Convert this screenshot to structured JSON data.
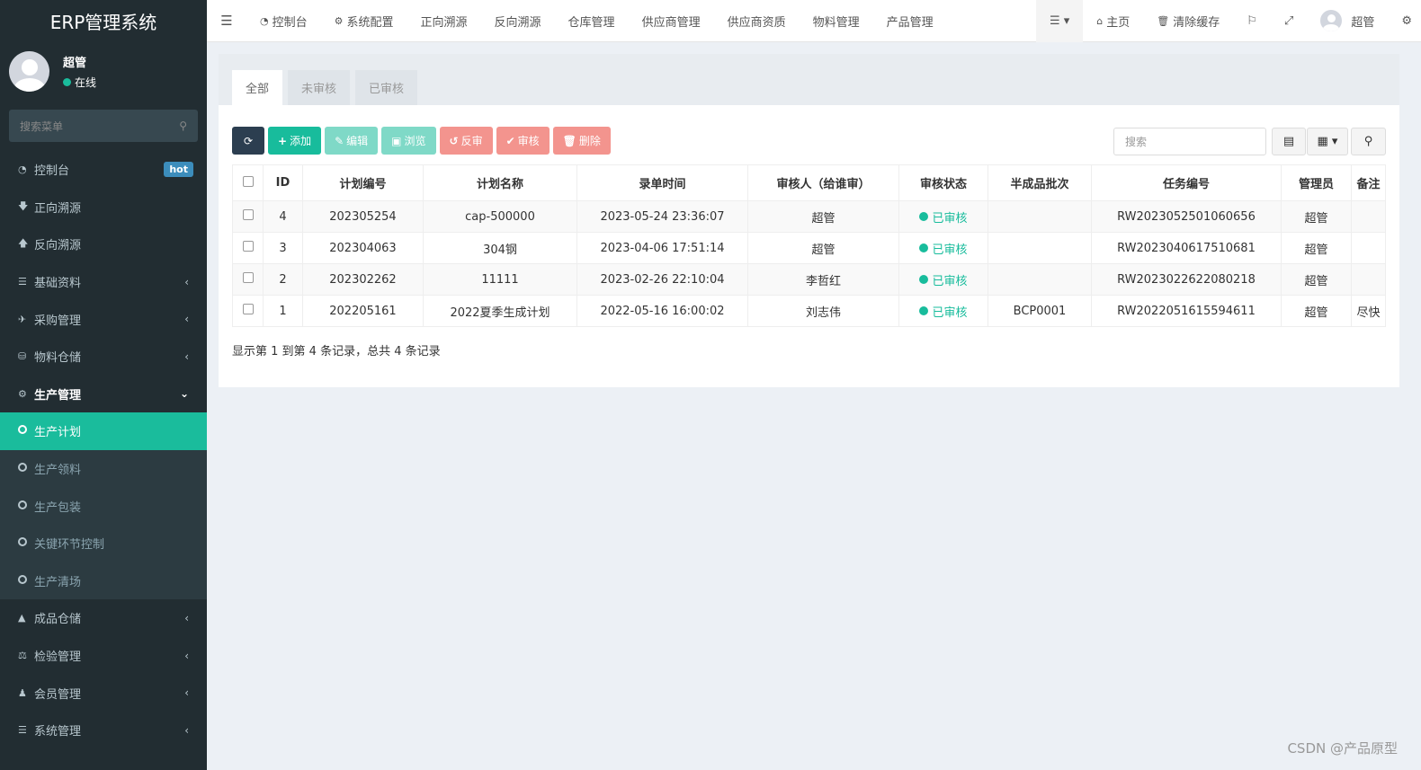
{
  "app": {
    "title": "ERP管理系统"
  },
  "user": {
    "name": "超管",
    "status": "在线"
  },
  "sidebar": {
    "search_placeholder": "搜索菜单",
    "items": [
      {
        "label": "控制台",
        "badge": "hot",
        "icon": "dashboard-icon"
      },
      {
        "label": "正向溯源",
        "icon": "arrow-down-icon"
      },
      {
        "label": "反向溯源",
        "icon": "arrow-up-icon"
      },
      {
        "label": "基础资料",
        "icon": "list-icon"
      },
      {
        "label": "采购管理",
        "icon": "plane-icon"
      },
      {
        "label": "物料仓储",
        "icon": "database-icon"
      },
      {
        "label": "生产管理",
        "icon": "gears-icon"
      },
      {
        "label": "生产计划",
        "icon": "circle-icon"
      },
      {
        "label": "生产领料",
        "icon": "circle-icon"
      },
      {
        "label": "生产包装",
        "icon": "circle-icon"
      },
      {
        "label": "关键环节控制",
        "icon": "circle-icon"
      },
      {
        "label": "生产清场",
        "icon": "circle-icon"
      },
      {
        "label": "成品仓储",
        "icon": "road-icon"
      },
      {
        "label": "检验管理",
        "icon": "balance-icon"
      },
      {
        "label": "会员管理",
        "icon": "user-icon"
      },
      {
        "label": "系统管理",
        "icon": "list-icon"
      }
    ]
  },
  "topnav": {
    "items": [
      "控制台",
      "系统配置",
      "正向溯源",
      "反向溯源",
      "仓库管理",
      "供应商管理",
      "供应商资质",
      "物料管理",
      "产品管理"
    ],
    "home": "主页",
    "clear_cache": "清除缓存",
    "user": "超管"
  },
  "tabs": [
    "全部",
    "未审核",
    "已审核"
  ],
  "toolbar": {
    "add": "添加",
    "edit": "编辑",
    "browse": "浏览",
    "unaudit": "反审",
    "audit": "审核",
    "delete": "删除"
  },
  "search_placeholder": "搜索",
  "table": {
    "headers": [
      "ID",
      "计划编号",
      "计划名称",
      "录单时间",
      "审核人（给谁审）",
      "审核状态",
      "半成品批次",
      "任务编号",
      "管理员",
      "备注"
    ],
    "rows": [
      {
        "id": "4",
        "code": "202305254",
        "name": "cap-500000",
        "time": "2023-05-24 23:36:07",
        "auditor": "超管",
        "status": "已审核",
        "batch": "",
        "task": "RW2023052501060656",
        "admin": "超管",
        "remark": ""
      },
      {
        "id": "3",
        "code": "202304063",
        "name": "304钢",
        "time": "2023-04-06 17:51:14",
        "auditor": "超管",
        "status": "已审核",
        "batch": "",
        "task": "RW2023040617510681",
        "admin": "超管",
        "remark": ""
      },
      {
        "id": "2",
        "code": "202302262",
        "name": "11111",
        "time": "2023-02-26 22:10:04",
        "auditor": "李哲红",
        "status": "已审核",
        "batch": "",
        "task": "RW2023022622080218",
        "admin": "超管",
        "remark": ""
      },
      {
        "id": "1",
        "code": "202205161",
        "name": "2022夏季生成计划",
        "time": "2022-05-16 16:00:02",
        "auditor": "刘志伟",
        "status": "已审核",
        "batch": "BCP0001",
        "task": "RW2022051615594611",
        "admin": "超管",
        "remark": "尽快"
      }
    ]
  },
  "summary": "显示第 1 到第 4 条记录，总共 4 条记录",
  "watermark": "CSDN @产品原型",
  "colors": {
    "sidebar": "#222d32",
    "accent": "#1abc9c",
    "primary_btn": "#18bc9c",
    "danger_btn": "#f3948e"
  }
}
